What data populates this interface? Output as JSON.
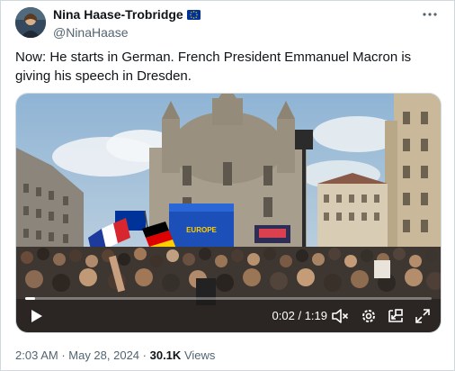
{
  "author": {
    "display_name": "Nina Haase-Trobridge",
    "handle": "@NinaHaase",
    "flag_icon": "eu-flag-icon"
  },
  "tweet": {
    "text": "Now: He starts in German. French President Emmanuel Macron is giving his speech in Dresden."
  },
  "video": {
    "elapsed": "0:02",
    "duration": "1:19",
    "time_separator": " / ",
    "progress_fraction": 0.025,
    "stage_sign": "EUROPE"
  },
  "meta": {
    "time": "2:03 AM",
    "date": "May 28, 2024",
    "separator": " · ",
    "views_count": "30.1K",
    "views_label": "Views"
  },
  "colors": {
    "eu_blue": "#003399",
    "eu_gold": "#ffcc00",
    "text_primary": "#0f1419",
    "text_secondary": "#536471"
  }
}
